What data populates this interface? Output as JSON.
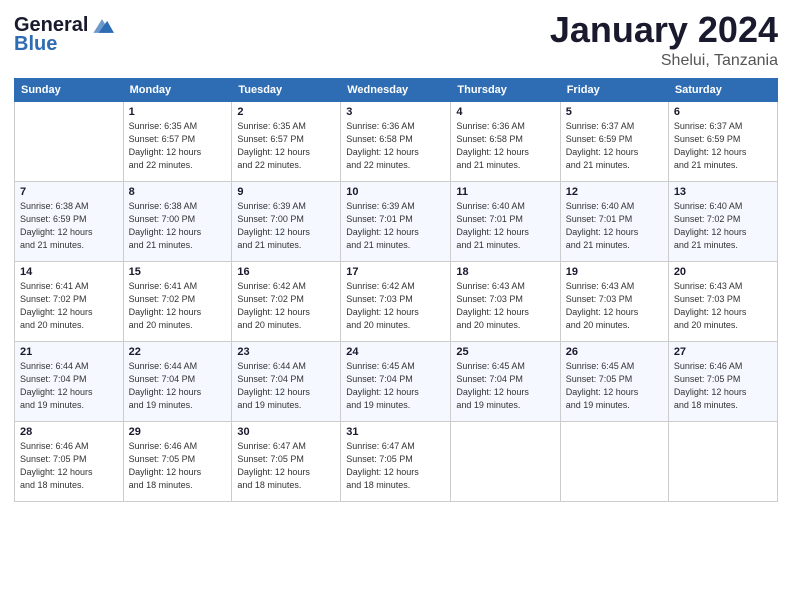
{
  "logo": {
    "general": "General",
    "blue": "Blue"
  },
  "header": {
    "month": "January 2024",
    "location": "Shelui, Tanzania"
  },
  "days_of_week": [
    "Sunday",
    "Monday",
    "Tuesday",
    "Wednesday",
    "Thursday",
    "Friday",
    "Saturday"
  ],
  "weeks": [
    [
      {
        "day": "",
        "info": ""
      },
      {
        "day": "1",
        "info": "Sunrise: 6:35 AM\nSunset: 6:57 PM\nDaylight: 12 hours\nand 22 minutes."
      },
      {
        "day": "2",
        "info": "Sunrise: 6:35 AM\nSunset: 6:57 PM\nDaylight: 12 hours\nand 22 minutes."
      },
      {
        "day": "3",
        "info": "Sunrise: 6:36 AM\nSunset: 6:58 PM\nDaylight: 12 hours\nand 22 minutes."
      },
      {
        "day": "4",
        "info": "Sunrise: 6:36 AM\nSunset: 6:58 PM\nDaylight: 12 hours\nand 21 minutes."
      },
      {
        "day": "5",
        "info": "Sunrise: 6:37 AM\nSunset: 6:59 PM\nDaylight: 12 hours\nand 21 minutes."
      },
      {
        "day": "6",
        "info": "Sunrise: 6:37 AM\nSunset: 6:59 PM\nDaylight: 12 hours\nand 21 minutes."
      }
    ],
    [
      {
        "day": "7",
        "info": "Sunrise: 6:38 AM\nSunset: 6:59 PM\nDaylight: 12 hours\nand 21 minutes."
      },
      {
        "day": "8",
        "info": "Sunrise: 6:38 AM\nSunset: 7:00 PM\nDaylight: 12 hours\nand 21 minutes."
      },
      {
        "day": "9",
        "info": "Sunrise: 6:39 AM\nSunset: 7:00 PM\nDaylight: 12 hours\nand 21 minutes."
      },
      {
        "day": "10",
        "info": "Sunrise: 6:39 AM\nSunset: 7:01 PM\nDaylight: 12 hours\nand 21 minutes."
      },
      {
        "day": "11",
        "info": "Sunrise: 6:40 AM\nSunset: 7:01 PM\nDaylight: 12 hours\nand 21 minutes."
      },
      {
        "day": "12",
        "info": "Sunrise: 6:40 AM\nSunset: 7:01 PM\nDaylight: 12 hours\nand 21 minutes."
      },
      {
        "day": "13",
        "info": "Sunrise: 6:40 AM\nSunset: 7:02 PM\nDaylight: 12 hours\nand 21 minutes."
      }
    ],
    [
      {
        "day": "14",
        "info": "Sunrise: 6:41 AM\nSunset: 7:02 PM\nDaylight: 12 hours\nand 20 minutes."
      },
      {
        "day": "15",
        "info": "Sunrise: 6:41 AM\nSunset: 7:02 PM\nDaylight: 12 hours\nand 20 minutes."
      },
      {
        "day": "16",
        "info": "Sunrise: 6:42 AM\nSunset: 7:02 PM\nDaylight: 12 hours\nand 20 minutes."
      },
      {
        "day": "17",
        "info": "Sunrise: 6:42 AM\nSunset: 7:03 PM\nDaylight: 12 hours\nand 20 minutes."
      },
      {
        "day": "18",
        "info": "Sunrise: 6:43 AM\nSunset: 7:03 PM\nDaylight: 12 hours\nand 20 minutes."
      },
      {
        "day": "19",
        "info": "Sunrise: 6:43 AM\nSunset: 7:03 PM\nDaylight: 12 hours\nand 20 minutes."
      },
      {
        "day": "20",
        "info": "Sunrise: 6:43 AM\nSunset: 7:03 PM\nDaylight: 12 hours\nand 20 minutes."
      }
    ],
    [
      {
        "day": "21",
        "info": "Sunrise: 6:44 AM\nSunset: 7:04 PM\nDaylight: 12 hours\nand 19 minutes."
      },
      {
        "day": "22",
        "info": "Sunrise: 6:44 AM\nSunset: 7:04 PM\nDaylight: 12 hours\nand 19 minutes."
      },
      {
        "day": "23",
        "info": "Sunrise: 6:44 AM\nSunset: 7:04 PM\nDaylight: 12 hours\nand 19 minutes."
      },
      {
        "day": "24",
        "info": "Sunrise: 6:45 AM\nSunset: 7:04 PM\nDaylight: 12 hours\nand 19 minutes."
      },
      {
        "day": "25",
        "info": "Sunrise: 6:45 AM\nSunset: 7:04 PM\nDaylight: 12 hours\nand 19 minutes."
      },
      {
        "day": "26",
        "info": "Sunrise: 6:45 AM\nSunset: 7:05 PM\nDaylight: 12 hours\nand 19 minutes."
      },
      {
        "day": "27",
        "info": "Sunrise: 6:46 AM\nSunset: 7:05 PM\nDaylight: 12 hours\nand 18 minutes."
      }
    ],
    [
      {
        "day": "28",
        "info": "Sunrise: 6:46 AM\nSunset: 7:05 PM\nDaylight: 12 hours\nand 18 minutes."
      },
      {
        "day": "29",
        "info": "Sunrise: 6:46 AM\nSunset: 7:05 PM\nDaylight: 12 hours\nand 18 minutes."
      },
      {
        "day": "30",
        "info": "Sunrise: 6:47 AM\nSunset: 7:05 PM\nDaylight: 12 hours\nand 18 minutes."
      },
      {
        "day": "31",
        "info": "Sunrise: 6:47 AM\nSunset: 7:05 PM\nDaylight: 12 hours\nand 18 minutes."
      },
      {
        "day": "",
        "info": ""
      },
      {
        "day": "",
        "info": ""
      },
      {
        "day": "",
        "info": ""
      }
    ]
  ]
}
